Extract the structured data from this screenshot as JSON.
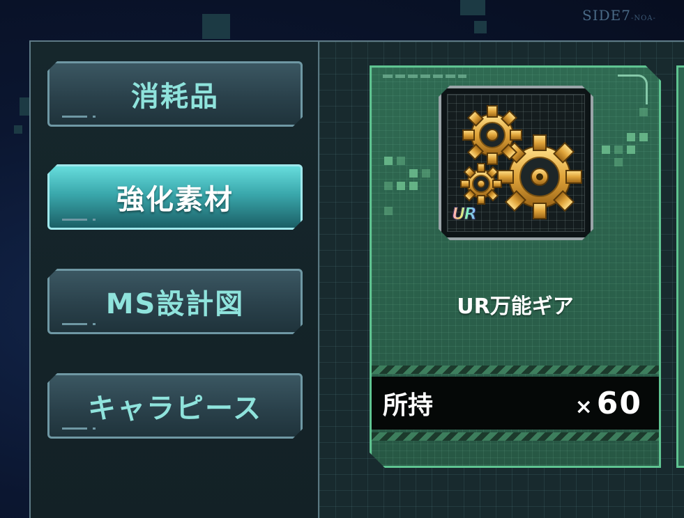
{
  "background": {
    "corner_text": "SIDE7",
    "corner_subtext": "-NOA-"
  },
  "sidebar": {
    "items": [
      {
        "label": "消耗品",
        "active": false
      },
      {
        "label": "強化素材",
        "active": true
      },
      {
        "label": "MS設計図",
        "active": false
      },
      {
        "label": "キャラピース",
        "active": false
      }
    ]
  },
  "item_card": {
    "icon": "gear-icon",
    "rarity": "UR",
    "name": "UR万能ギア",
    "owned_label": "所持",
    "owned_count": "60",
    "owned_prefix": "×"
  },
  "colors": {
    "accent": "#5fc491",
    "active_tab": "#4fc4c8",
    "card_bg": "#2f6a52"
  }
}
